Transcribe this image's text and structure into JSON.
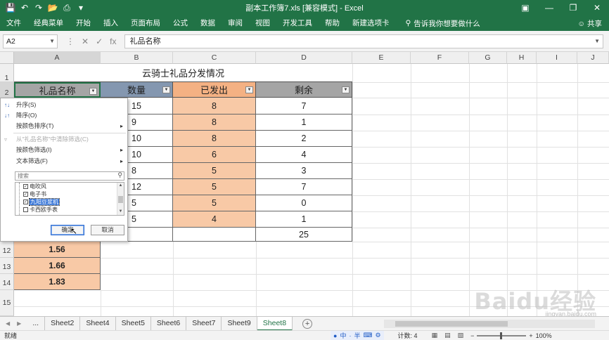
{
  "titlebar": {
    "title": "副本工作簿7.xls  [兼容模式]  -  Excel",
    "qat_icons": [
      "save-icon",
      "undo-icon",
      "redo-icon",
      "open-icon",
      "print-preview-icon",
      "customize-icon"
    ],
    "window_buttons": [
      "ribbon-display-icon",
      "minimize-icon",
      "restore-icon",
      "close-icon"
    ]
  },
  "ribbon": {
    "tabs": [
      "文件",
      "经典菜单",
      "开始",
      "插入",
      "页面布局",
      "公式",
      "数据",
      "审阅",
      "视图",
      "开发工具",
      "帮助",
      "新建选项卡"
    ],
    "search_placeholder": "告诉我你想要做什么",
    "share": "共享"
  },
  "formula_bar": {
    "name_box": "A2",
    "fx": "fx",
    "content": "礼品名称"
  },
  "columns": [
    "A",
    "B",
    "C",
    "D",
    "E",
    "F",
    "G",
    "H",
    "I",
    "J"
  ],
  "rows": [
    "1",
    "2",
    "12",
    "13",
    "14",
    "15"
  ],
  "sheet": {
    "title": "云骑士礼品分发情况",
    "headers": [
      "礼品名称",
      "数量",
      "已发出",
      "剩余"
    ],
    "quantity": [
      "15",
      "9",
      "10",
      "10",
      "8",
      "12",
      "5",
      "5"
    ],
    "sent": [
      "8",
      "8",
      "8",
      "6",
      "5",
      "5",
      "5",
      "4"
    ],
    "remaining": [
      "7",
      "1",
      "2",
      "4",
      "3",
      "7",
      "0",
      "1"
    ],
    "total_remaining": "25",
    "a_values": [
      "1.56",
      "1.66",
      "1.83"
    ]
  },
  "filter_menu": {
    "sort_asc": "升序(S)",
    "sort_desc": "降序(O)",
    "sort_by_color": "按颜色排序(T)",
    "clear_filter": "从\"礼品名称\"中清除筛选(C)",
    "filter_by_color": "按颜色筛选(I)",
    "text_filters": "文本筛选(F)",
    "search_placeholder": "搜索",
    "items": [
      {
        "label": "电吹风",
        "checked": true
      },
      {
        "label": "电子书",
        "checked": true
      },
      {
        "label": "九阳豆浆机",
        "checked": true
      },
      {
        "label": "卡西欧手表",
        "checked": false
      }
    ],
    "ok": "确定",
    "cancel": "取消"
  },
  "sheet_tabs": [
    "...",
    "Sheet2",
    "Sheet4",
    "Sheet5",
    "Sheet6",
    "Sheet7",
    "Sheet9",
    "Sheet8"
  ],
  "active_sheet": "Sheet8",
  "statusbar": {
    "ready": "就绪",
    "ime": [
      "中",
      "·",
      "半"
    ],
    "count": "计数: 4",
    "zoom": "100%"
  },
  "watermark": {
    "text": "Baidu经验",
    "sub": "jingyan.baidu.com"
  },
  "colors": {
    "excel_green": "#217346",
    "orange_cell": "#f8c9a6",
    "orange_header": "#f4b183",
    "gray_header": "#a5a5a5",
    "blue_header": "#8497b0"
  }
}
